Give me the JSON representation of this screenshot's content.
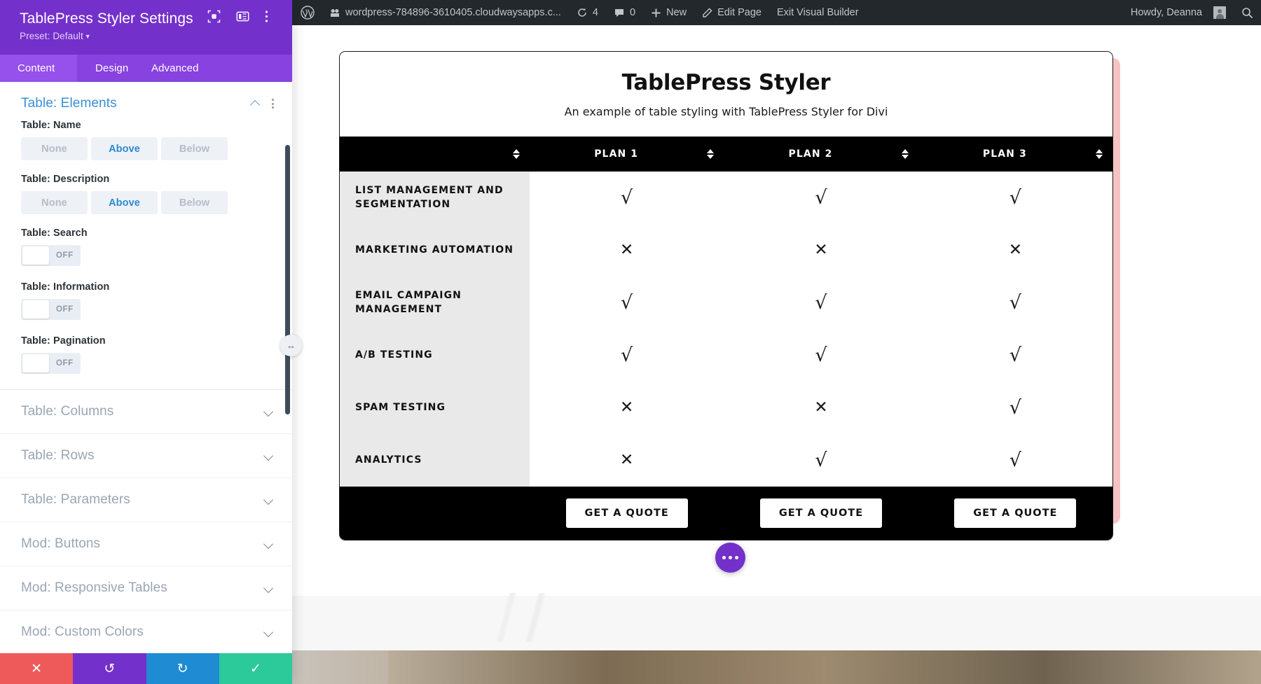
{
  "settings_panel": {
    "title": "TablePress Styler Settings",
    "preset_label": "Preset: Default",
    "header_icons": [
      "focus-target-icon",
      "layout-panel-icon",
      "kebab-menu-icon"
    ],
    "tabs": [
      {
        "label": "Content",
        "active": true
      },
      {
        "label": "Design",
        "active": false
      },
      {
        "label": "Advanced",
        "active": false
      }
    ],
    "open_section": {
      "title": "Table: Elements",
      "fields": [
        {
          "label": "Table: Name",
          "type": "segmented",
          "options": [
            "None",
            "Above",
            "Below"
          ],
          "value": "Above"
        },
        {
          "label": "Table: Description",
          "type": "segmented",
          "options": [
            "None",
            "Above",
            "Below"
          ],
          "value": "Above"
        },
        {
          "label": "Table: Search",
          "type": "toggle",
          "value": "OFF"
        },
        {
          "label": "Table: Information",
          "type": "toggle",
          "value": "OFF"
        },
        {
          "label": "Table: Pagination",
          "type": "toggle",
          "value": "OFF"
        }
      ]
    },
    "collapsed_sections": [
      {
        "label": "Table: Columns"
      },
      {
        "label": "Table: Rows"
      },
      {
        "label": "Table: Parameters"
      },
      {
        "label": "Mod: Buttons"
      },
      {
        "label": "Mod: Responsive Tables"
      },
      {
        "label": "Mod: Custom Colors"
      }
    ],
    "footer_actions": [
      {
        "name": "cancel",
        "glyph": "✕",
        "color": "#ee5a5a"
      },
      {
        "name": "undo",
        "glyph": "↺",
        "color": "#7430cb"
      },
      {
        "name": "redo",
        "glyph": "↻",
        "color": "#1f8bd3"
      },
      {
        "name": "save",
        "glyph": "✓",
        "color": "#2cc99b"
      }
    ],
    "accent_color": "#7430cb",
    "tab_active_color": "#9650ec",
    "section_title_color": "#3a8fd6"
  },
  "admin_bar": {
    "wp_logo": "wordpress-logo-icon",
    "site_name": "wordpress-784896-3610405.cloudwaysapps.c...",
    "updates_count": "4",
    "comments_count": "0",
    "new_label": "New",
    "edit_page_label": "Edit Page",
    "exit_builder_label": "Exit Visual Builder",
    "howdy_label": "Howdy, Deanna",
    "search_icon": "search-icon"
  },
  "page": {
    "table": {
      "name": "TablePress Styler",
      "description": "An example of table styling with TablePress Styler for Divi",
      "columns": [
        "",
        "PLAN 1",
        "PLAN 2",
        "PLAN 3"
      ],
      "rows": [
        {
          "feature": "LIST MANAGEMENT AND SEGMENTATION",
          "values": [
            "√",
            "√",
            "√"
          ]
        },
        {
          "feature": "MARKETING AUTOMATION",
          "values": [
            "✕",
            "✕",
            "✕"
          ]
        },
        {
          "feature": "EMAIL CAMPAIGN MANAGEMENT",
          "values": [
            "√",
            "√",
            "√"
          ]
        },
        {
          "feature": "A/B TESTING",
          "values": [
            "√",
            "√",
            "√"
          ]
        },
        {
          "feature": "SPAM TESTING",
          "values": [
            "✕",
            "✕",
            "√"
          ]
        },
        {
          "feature": "ANALYTICS",
          "values": [
            "✕",
            "√",
            "√"
          ]
        }
      ],
      "footer_buttons": [
        "GET A QUOTE",
        "GET A QUOTE",
        "GET A QUOTE"
      ],
      "header_bg": "#000000",
      "shadow_color": "#f6c3c3",
      "row_header_bg": "#e9e9e9"
    },
    "fab": "more-options-icon"
  }
}
